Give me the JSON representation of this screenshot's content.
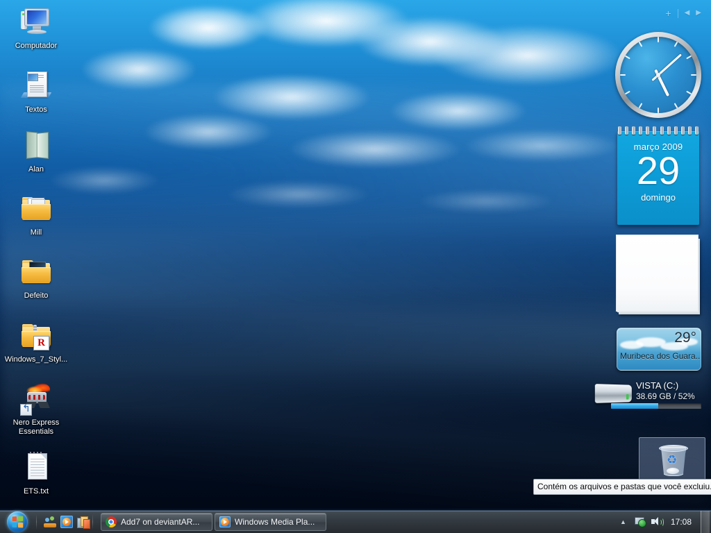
{
  "desktop": {
    "icons": [
      {
        "label": "Computador",
        "icon": "computer-icon"
      },
      {
        "label": "Textos",
        "icon": "document-icon"
      },
      {
        "label": "Alan",
        "icon": "book-icon"
      },
      {
        "label": "Mill",
        "icon": "folder-icon"
      },
      {
        "label": "Defeito",
        "icon": "folder-open-icon"
      },
      {
        "label": "Windows_7_Styl...",
        "icon": "zip-folder-icon"
      },
      {
        "label": "Nero Express Essentials",
        "icon": "nero-shortcut-icon"
      },
      {
        "label": "ETS.txt",
        "icon": "text-file-icon"
      }
    ],
    "recycle_bin": {
      "icon": "recycle-bin-icon",
      "tooltip": "Contém os arquivos e pastas que você excluiu."
    }
  },
  "sidebar": {
    "header": {
      "add_label": "+",
      "prev_label": "◀",
      "next_label": "▶"
    },
    "clock": {
      "icon": "analog-clock-gadget",
      "hour_deg": 154,
      "minute_deg": 48
    },
    "calendar": {
      "month": "março 2009",
      "day": "29",
      "weekday": "domingo"
    },
    "notes": {
      "icon": "sticky-notes-gadget",
      "text": ""
    },
    "weather": {
      "temperature": "29°",
      "location": "Muribeca dos Guara..."
    },
    "drive": {
      "name": "VISTA (C:)",
      "info": "38.69 GB / 52%",
      "percent": 52,
      "fill_color": "#32a8e8"
    }
  },
  "taskbar": {
    "start": {
      "label": "Iniciar",
      "icon": "windows-start-orb"
    },
    "quicklaunch": [
      {
        "name": "show-desktop-icon",
        "label": "Mostrar Área de Trabalho"
      },
      {
        "name": "windows-media-player-icon",
        "label": "Windows Media Player"
      },
      {
        "name": "flip3d-icon",
        "label": "Alternar entre janelas"
      }
    ],
    "tasks": [
      {
        "label": "Add7 on deviantAR...",
        "icon": "chrome-icon"
      },
      {
        "label": "Windows Media Pla...",
        "icon": "wmp-icon"
      }
    ],
    "tray": {
      "overflow_label": "▲",
      "network_icon": "network-icon",
      "volume_icon": "volume-icon",
      "clock": "17:08",
      "show_desktop_label": "Mostrar área de trabalho"
    }
  }
}
